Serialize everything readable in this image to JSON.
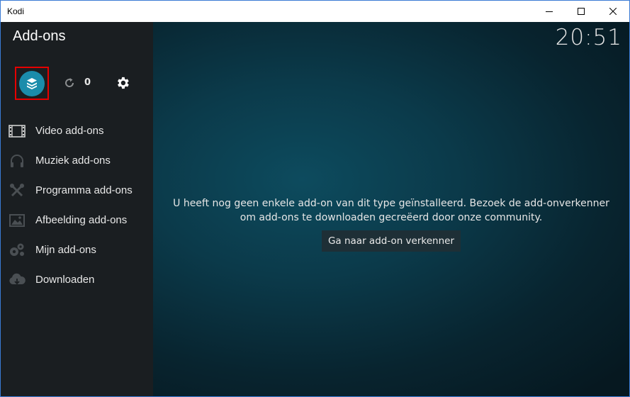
{
  "window": {
    "title": "Kodi",
    "controls": {
      "minimize_icon": "minimize-icon",
      "maximize_icon": "maximize-icon",
      "close_icon": "close-icon"
    }
  },
  "header": {
    "title": "Add-ons",
    "clock": "20:51"
  },
  "toolbar": {
    "addon_browser_icon": "open-box-icon",
    "update_icon": "refresh-icon",
    "update_count": "0",
    "settings_icon": "gear-icon"
  },
  "sidebar": {
    "items": [
      {
        "label": "Video add-ons",
        "icon": "film-icon"
      },
      {
        "label": "Muziek add-ons",
        "icon": "headphones-icon"
      },
      {
        "label": "Programma add-ons",
        "icon": "tools-icon"
      },
      {
        "label": "Afbeelding add-ons",
        "icon": "picture-icon"
      },
      {
        "label": "Mijn add-ons",
        "icon": "gears-icon"
      },
      {
        "label": "Downloaden",
        "icon": "cloud-download-icon"
      }
    ]
  },
  "main": {
    "message_line1": "U heeft nog geen enkele add-on van dit type geïnstalleerd. Bezoek de add-onverkenner",
    "message_line2": "om add-ons te downloaden gecreëerd door onze community.",
    "button_label": "Ga naar add-on verkenner"
  },
  "colors": {
    "accent": "#1b8cab",
    "highlight_border": "#e60000",
    "sidebar_bg": "#1a1e21",
    "background": "#0b3a4a"
  }
}
